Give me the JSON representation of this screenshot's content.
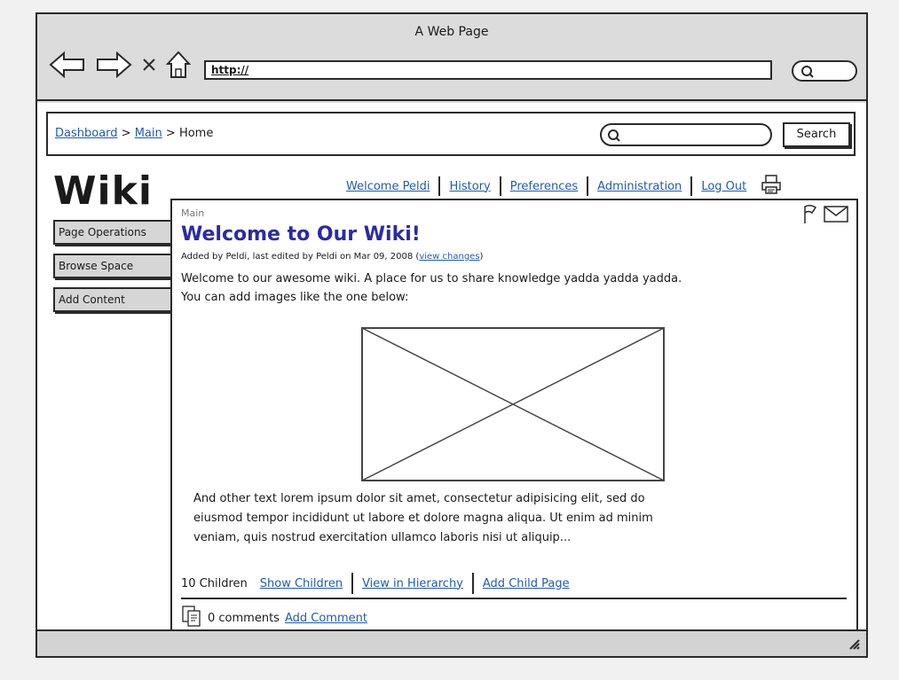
{
  "browser": {
    "title": "A Web Page",
    "address": "http://"
  },
  "breadcrumb": {
    "items": [
      "Dashboard",
      "Main",
      "Home"
    ],
    "sep": ">"
  },
  "search": {
    "button_label": "Search"
  },
  "site": {
    "logo": "Wiki"
  },
  "toplinks": [
    "Welcome Peldi",
    "History",
    "Preferences",
    "Administration",
    "Log Out"
  ],
  "sidebar": {
    "items": [
      "Page Operations",
      "Browse Space",
      "Add Content"
    ]
  },
  "page": {
    "space": "Main",
    "title": "Welcome to Our Wiki!",
    "meta_prefix": "Added by Peldi, last edited by Peldi on Mar 09, 2008 (",
    "meta_link": "view changes",
    "meta_suffix": ")",
    "intro_line1": "Welcome to our awesome wiki. A place for us to share knowledge yadda yadda yadda.",
    "intro_line2": "You can add images like the one below:",
    "body_line1": "And other text lorem ipsum dolor sit amet, consectetur adipisicing elit, sed do",
    "body_line2": "eiusmod tempor incididunt ut labore et dolore magna aliqua. Ut enim ad minim",
    "body_line3": "veniam, quis nostrud exercitation ullamco laboris nisi ut aliquip..."
  },
  "children": {
    "count_label": "10 Children",
    "links": [
      "Show Children",
      "View in Hierarchy",
      "Add Child Page"
    ]
  },
  "comments": {
    "count_label": "0 comments",
    "add_label": "Add Comment"
  },
  "icons": {
    "back": "back-arrow-icon",
    "forward": "forward-arrow-icon",
    "stop": "close-icon",
    "home": "home-icon",
    "search": "search-icon",
    "print": "printer-icon",
    "watch": "flag-icon",
    "email": "envelope-icon",
    "comments": "document-icon",
    "resize": "resize-grip-icon"
  },
  "colors": {
    "link": "#1f5bb5",
    "title": "#2a2aa8",
    "chrome": "#dcdcdc",
    "sidebar_button": "#d6d6d6"
  }
}
